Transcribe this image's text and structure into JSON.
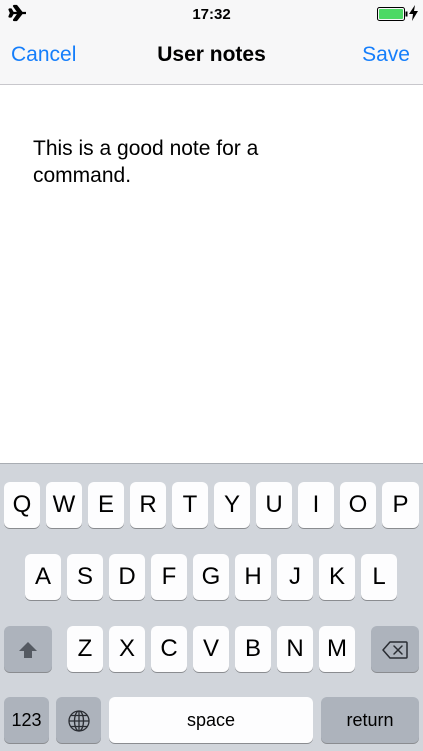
{
  "status_bar": {
    "time": "17:32",
    "left_icon": "airplane-icon",
    "battery_icon": "battery-icon",
    "charging_icon": "charging-bolt-icon",
    "battery_color": "#4cd964"
  },
  "nav": {
    "cancel_label": "Cancel",
    "title": "User notes",
    "save_label": "Save",
    "accent_color": "#157efb"
  },
  "note": {
    "text": "This is a good note for a command."
  },
  "keyboard": {
    "row1": [
      "Q",
      "W",
      "E",
      "R",
      "T",
      "Y",
      "U",
      "I",
      "O",
      "P"
    ],
    "row2": [
      "A",
      "S",
      "D",
      "F",
      "G",
      "H",
      "J",
      "K",
      "L"
    ],
    "row3": [
      "Z",
      "X",
      "C",
      "V",
      "B",
      "N",
      "M"
    ],
    "shift_icon": "shift-arrow-icon",
    "delete_icon": "backspace-icon",
    "numbers_label": "123",
    "globe_icon": "globe-icon",
    "space_label": "space",
    "return_label": "return"
  }
}
